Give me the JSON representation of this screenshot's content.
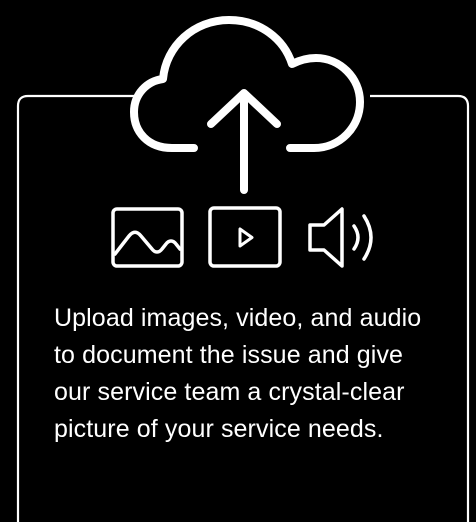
{
  "colors": {
    "background": "#000000",
    "foreground": "#ffffff"
  },
  "icons": {
    "upload": "cloud-upload-icon",
    "image": "image-icon",
    "video": "video-play-icon",
    "audio": "speaker-icon"
  },
  "card": {
    "description": "Upload images, video, and audio to document the issue and give our service team a crystal-clear picture of your service needs."
  }
}
